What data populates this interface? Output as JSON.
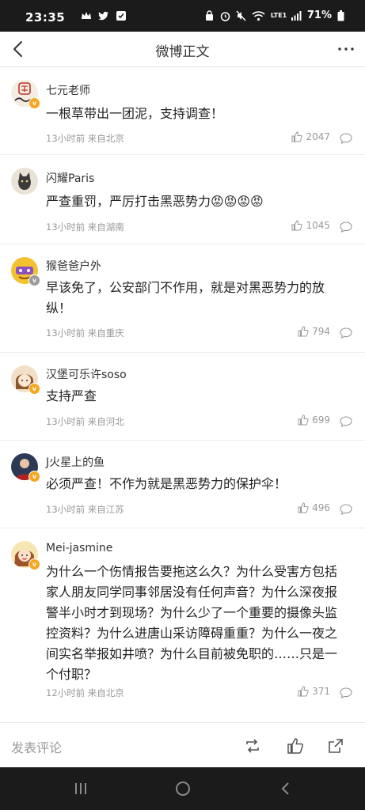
{
  "status_bar": {
    "time": "23:35",
    "battery": "71%",
    "network": "LTE1"
  },
  "header": {
    "title": "微博正文"
  },
  "comments": [
    {
      "username": "七元老师",
      "text": "一根草带出一团泥，支持调查！",
      "meta": "13小时前 来自北京",
      "likes": "2047",
      "avatar_icon": "avatar-seal-icon",
      "verified": "gold"
    },
    {
      "username": "闪耀Paris",
      "text": "严查重罚，严厉打击黑恶势力😡😡😡😡",
      "meta": "13小时前 来自湖南",
      "likes": "1045",
      "avatar_icon": "avatar-cat-icon",
      "verified": "none"
    },
    {
      "username": "猴爸爸户外",
      "text": "早该免了，公安部门不作用，就是对黑恶势力的放纵！",
      "meta": "13小时前 来自重庆",
      "likes": "794",
      "avatar_icon": "avatar-cartoon-icon",
      "verified": "gray"
    },
    {
      "username": "汉堡可乐许soso",
      "text": "支持严查",
      "meta": "13小时前 来自河北",
      "likes": "699",
      "avatar_icon": "avatar-girl-icon",
      "verified": "gold"
    },
    {
      "username": "J火星上的鱼",
      "text": "必须严查！不作为就是黑恶势力的保护伞！",
      "meta": "13小时前 来自江苏",
      "likes": "496",
      "avatar_icon": "avatar-person-icon",
      "verified": "gold"
    },
    {
      "username": "Mei-jasmine",
      "text": "为什么一个伤情报告要拖这么久？为什么受害方包括家人朋友同学同事邻居没有任何声音？为什么深夜报警半小时才到现场？为什么少了一个重要的摄像头监控资料？为什么进唐山采访障碍重重？为什么一夜之间实名举报如井喷？为什么目前被免职的……只是一个付职？",
      "meta": "12小时前 来自北京",
      "likes": "371",
      "avatar_icon": "avatar-cartoon-girl-icon",
      "verified": "gold"
    }
  ],
  "bottom_bar": {
    "comment_placeholder": "发表评论"
  },
  "colors": {
    "verified_gold": "#f5a623",
    "text_primary": "#222222",
    "text_meta": "#999999",
    "system_bar": "#1b1b1b"
  }
}
